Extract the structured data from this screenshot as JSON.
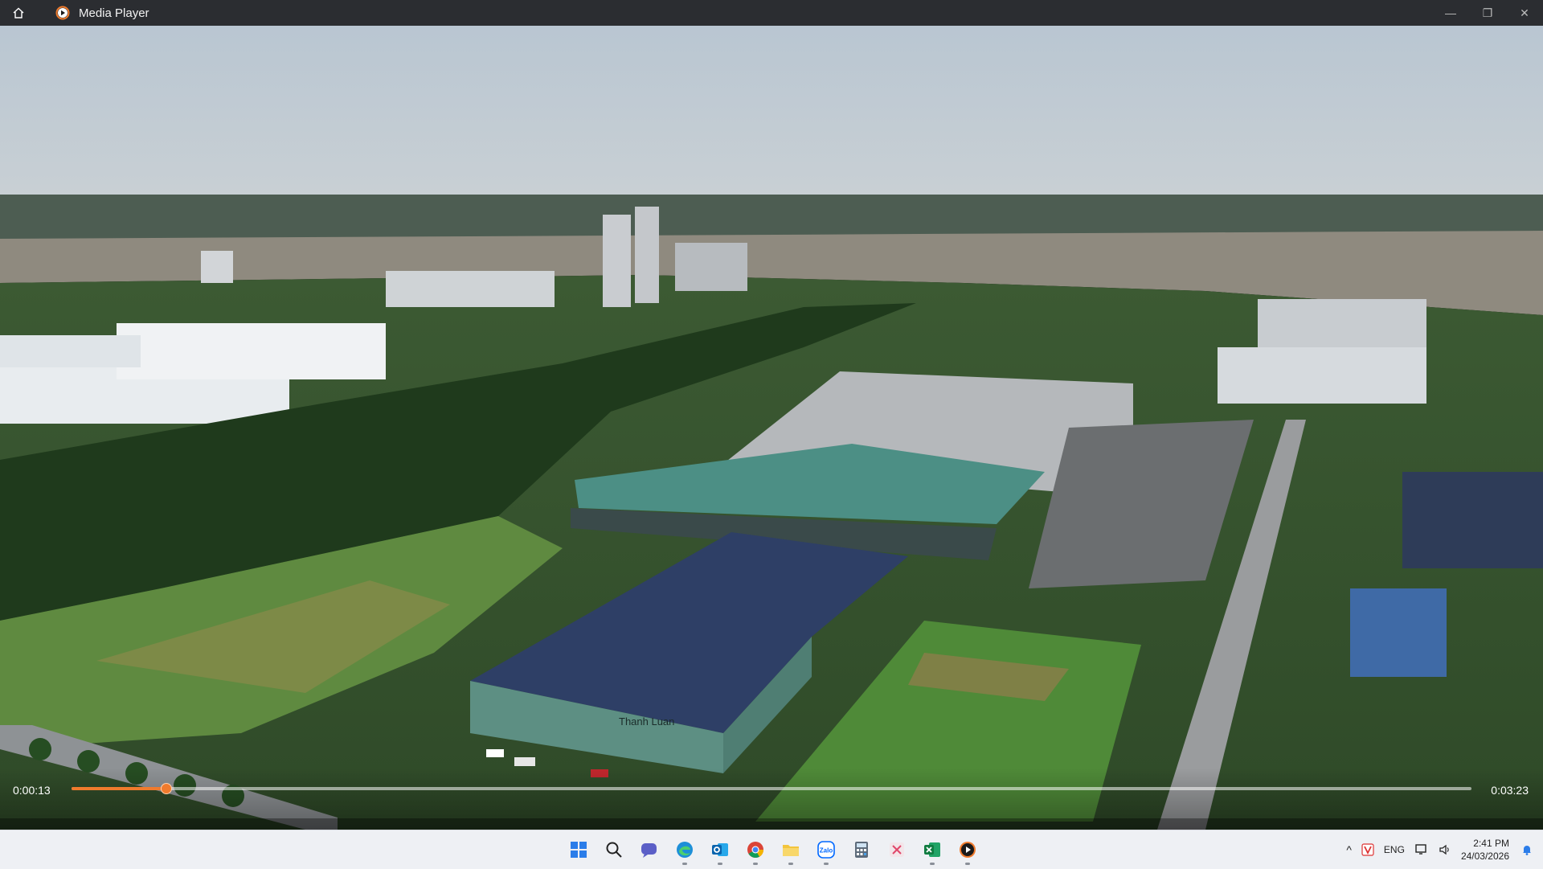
{
  "app": {
    "title": "Media Player"
  },
  "titlebar": {
    "minimize": "—",
    "restore": "❐",
    "close": "✕"
  },
  "player": {
    "current_time": "0:00:13",
    "total_time": "0:03:23",
    "progress_fraction": 0.068,
    "accent_color": "#f07b2d",
    "video_text": {
      "sign": "Thanh Luan"
    }
  },
  "taskbar": {
    "apps": [
      {
        "name": "start-icon"
      },
      {
        "name": "search-icon"
      },
      {
        "name": "chat-icon"
      },
      {
        "name": "edge-icon"
      },
      {
        "name": "outlook-icon"
      },
      {
        "name": "chrome-icon"
      },
      {
        "name": "file-explorer-icon"
      },
      {
        "name": "zalo-icon",
        "label": "Zalo"
      },
      {
        "name": "calculator-icon"
      },
      {
        "name": "snipping-tool-icon"
      },
      {
        "name": "excel-icon"
      },
      {
        "name": "media-player-icon"
      }
    ],
    "tray": {
      "chevron": "^",
      "language": "ENG",
      "time": "2:41 PM",
      "date": "24/03/2026"
    }
  }
}
